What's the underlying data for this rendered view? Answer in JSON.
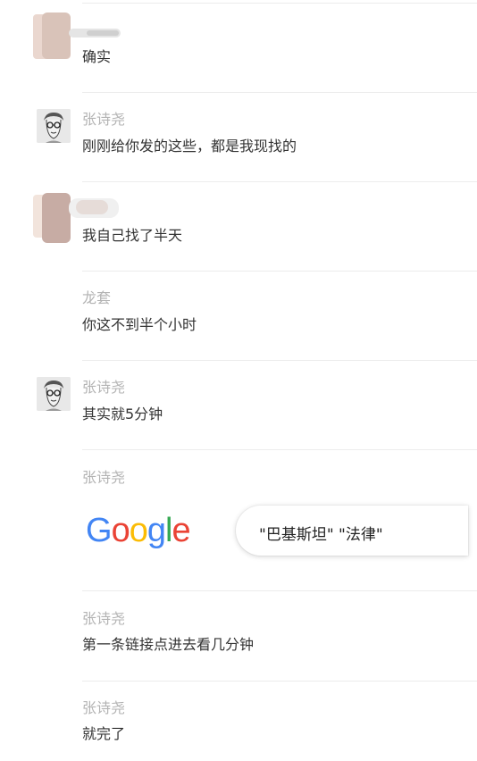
{
  "messages": [
    {
      "name": "",
      "text": "确实",
      "avatar": "blurred-avatar"
    },
    {
      "name": "张诗尧",
      "text": "刚刚给你发的这些，都是我现找的",
      "avatar": "sketch-face-avatar"
    },
    {
      "name": "",
      "text": "我自己找了半天",
      "avatar": "blurred-avatar"
    },
    {
      "name": "龙套",
      "text": "你这不到半个小时",
      "avatar": ""
    },
    {
      "name": "张诗尧",
      "text": "其实就5分钟",
      "avatar": "sketch-face-avatar"
    },
    {
      "name": "张诗尧",
      "text": "",
      "avatar": ""
    },
    {
      "name": "张诗尧",
      "text": "第一条链接点进去看几分钟",
      "avatar": ""
    },
    {
      "name": "张诗尧",
      "text": "就完了",
      "avatar": ""
    }
  ],
  "google_card": {
    "logo_letters": [
      "G",
      "o",
      "o",
      "g",
      "l",
      "e"
    ],
    "logo_colors": [
      "#4285F4",
      "#EA4335",
      "#FBBC05",
      "#4285F4",
      "#34A853",
      "#EA4335"
    ],
    "search_query": "\"巴基斯坦\" \"法律\""
  },
  "colors": {
    "name": "#b3b3b3",
    "text": "#333333",
    "divider": "#ececec"
  }
}
